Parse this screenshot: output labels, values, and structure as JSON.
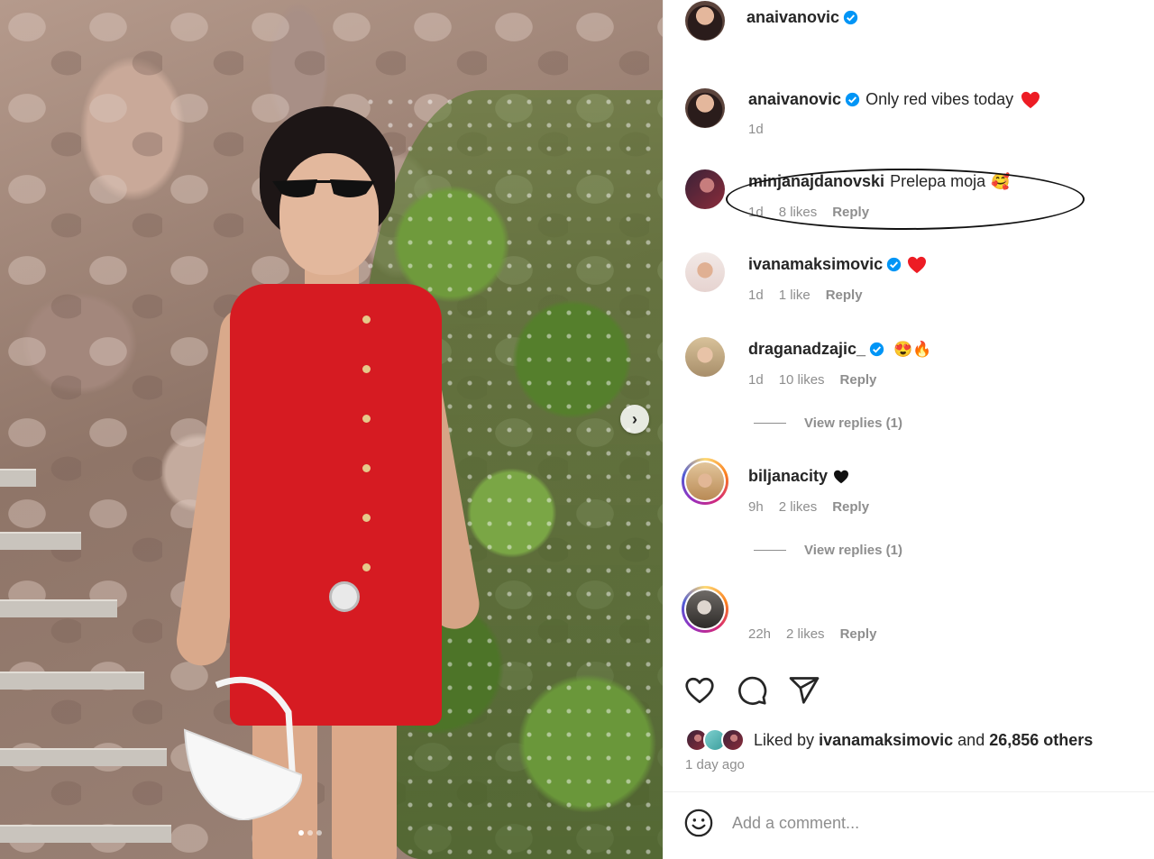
{
  "post": {
    "author": "anaivanovic",
    "caption": "Only red vibes today",
    "caption_age": "1d",
    "caption_emoji": "red-heart"
  },
  "comments": [
    {
      "user": "minjanajdanovski",
      "text": "Prelepa moja",
      "emoji": "smiling-face-with-hearts",
      "age": "1d",
      "likes": "8 likes",
      "reply": "Reply",
      "verified": false
    },
    {
      "user": "ivanamaksimovic",
      "text": "",
      "emoji": "red-heart",
      "age": "1d",
      "likes": "1 like",
      "reply": "Reply",
      "verified": true
    },
    {
      "user": "draganadzajic_",
      "text": "",
      "emoji": "heart-eyes-fire",
      "age": "1d",
      "likes": "10 likes",
      "reply": "Reply",
      "verified": true,
      "view_replies": "View replies (1)"
    },
    {
      "user": "biljanacity",
      "text": "",
      "emoji": "black-heart",
      "age": "9h",
      "likes": "2 likes",
      "reply": "Reply",
      "verified": false,
      "view_replies": "View replies (1)"
    },
    {
      "user": "",
      "text": "",
      "age": "22h",
      "likes": "2 likes",
      "reply": "Reply",
      "verified": false
    }
  ],
  "likes": {
    "prefix": "Liked by",
    "user": "ivanamaksimovic",
    "connector": "and",
    "others": "26,856 others"
  },
  "time_ago": "1 day ago",
  "comment_box": {
    "placeholder": "Add a comment..."
  },
  "carousel": {
    "current": 1,
    "total": 3
  },
  "colors": {
    "verified": "#0095f6",
    "heart_red": "#ed1c24",
    "dress_red": "#d61b22",
    "muted_text": "#8e8e8e"
  },
  "icons": [
    "verified-badge-icon",
    "heart-icon",
    "comment-icon",
    "share-icon",
    "emoji-icon",
    "carousel-next-icon"
  ]
}
